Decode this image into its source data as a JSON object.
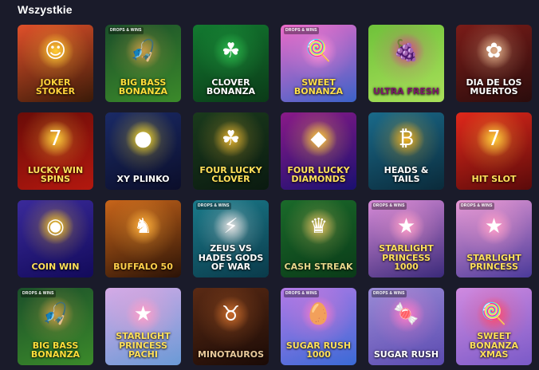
{
  "section": {
    "title": "Wszystkie"
  },
  "badge_text": "DROPS & WINS",
  "games": [
    {
      "title": "Joker Stoker",
      "bg1": "#3a1a08",
      "bg2": "#e0502a",
      "accent": "#ffcc33",
      "text_color": "#ffd23a",
      "emblem": "☺",
      "badge": false
    },
    {
      "title": "Big Bass Bonanza",
      "bg1": "#3b8a2a",
      "bg2": "#1b4f2a",
      "accent": "#c79b47",
      "text_color": "#ffdf3a",
      "emblem": "🎣",
      "badge": true
    },
    {
      "title": "Clover Bonanza",
      "bg1": "#0b3a18",
      "bg2": "#127a30",
      "accent": "#2ab54a",
      "text_color": "#ffffff",
      "emblem": "☘",
      "badge": false
    },
    {
      "title": "Sweet Bonanza",
      "bg1": "#3a62c8",
      "bg2": "#ec6cc8",
      "accent": "#ff8ed5",
      "text_color": "#ffe04a",
      "emblem": "🍭",
      "badge": true
    },
    {
      "title": "Ultra Fresh",
      "bg1": "#a9e05a",
      "bg2": "#6fc23a",
      "accent": "#d6458a",
      "text_color": "#7a1a68",
      "emblem": "🍇",
      "badge": false
    },
    {
      "title": "Dia de los Muertos",
      "bg1": "#2a0c0c",
      "bg2": "#7a1c18",
      "accent": "#e0b08a",
      "text_color": "#ffffff",
      "emblem": "✿",
      "badge": false
    },
    {
      "title": "Lucky Win Spins",
      "bg1": "#b3180f",
      "bg2": "#6a0c08",
      "accent": "#ffcf3a",
      "text_color": "#ffe05a",
      "emblem": "7",
      "badge": false
    },
    {
      "title": "XY Plinko",
      "bg1": "#0b0e2a",
      "bg2": "#1a2a66",
      "accent": "#ffe02a",
      "text_color": "#ffffff",
      "emblem": "●",
      "badge": false
    },
    {
      "title": "Four Lucky Clover",
      "bg1": "#0a1a10",
      "bg2": "#1a3a1c",
      "accent": "#e0b030",
      "text_color": "#ffe05a",
      "emblem": "☘",
      "badge": false
    },
    {
      "title": "Four Lucky Diamonds",
      "bg1": "#1a1070",
      "bg2": "#8a1a88",
      "accent": "#ffcf3a",
      "text_color": "#ffe05a",
      "emblem": "◆",
      "badge": false
    },
    {
      "title": "Heads & Tails",
      "bg1": "#0a2a3a",
      "bg2": "#1a6a8a",
      "accent": "#f0b020",
      "text_color": "#ffffff",
      "emblem": "₿",
      "badge": false
    },
    {
      "title": "Hit Slot",
      "bg1": "#5a0a0a",
      "bg2": "#e0281a",
      "accent": "#ffcf3a",
      "text_color": "#ffe05a",
      "emblem": "7",
      "badge": false
    },
    {
      "title": "Coin Win",
      "bg1": "#120a5a",
      "bg2": "#3a2a9a",
      "accent": "#ffcc22",
      "text_color": "#ffe05a",
      "emblem": "◉",
      "badge": false
    },
    {
      "title": "Buffalo 50",
      "bg1": "#2a1206",
      "bg2": "#c8651a",
      "accent": "#ffb03a",
      "text_color": "#ffcf4a",
      "emblem": "♞",
      "badge": false
    },
    {
      "title": "Zeus vs Hades Gods of War",
      "bg1": "#0a3a4a",
      "bg2": "#1a7a8a",
      "accent": "#e0e0e0",
      "text_color": "#ffffff",
      "emblem": "⚡",
      "badge": true
    },
    {
      "title": "Cash Streak",
      "bg1": "#0a3a18",
      "bg2": "#1a6a2a",
      "accent": "#e0c060",
      "text_color": "#e6d68a",
      "emblem": "♛",
      "badge": false
    },
    {
      "title": "Starlight Princess 1000",
      "bg1": "#3a2a7a",
      "bg2": "#d68ad6",
      "accent": "#ff9ec8",
      "text_color": "#ffe05a",
      "emblem": "★",
      "badge": true
    },
    {
      "title": "Starlight Princess",
      "bg1": "#4a3a9a",
      "bg2": "#e89ad6",
      "accent": "#ff9ec8",
      "text_color": "#ffe05a",
      "emblem": "★",
      "badge": true
    },
    {
      "title": "Big Bass Bonanza",
      "bg1": "#3b8a2a",
      "bg2": "#1b4f2a",
      "accent": "#c79b47",
      "text_color": "#ffdf3a",
      "emblem": "🎣",
      "badge": true
    },
    {
      "title": "Starlight Princess Pachi",
      "bg1": "#6a9ad6",
      "bg2": "#d6aae6",
      "accent": "#ff9ec8",
      "text_color": "#ffe05a",
      "emblem": "★",
      "badge": false
    },
    {
      "title": "Minotauros",
      "bg1": "#1a0a06",
      "bg2": "#5a2a14",
      "accent": "#c86a2a",
      "text_color": "#e8c89a",
      "emblem": "♉",
      "badge": false
    },
    {
      "title": "Sugar Rush 1000",
      "bg1": "#3a6ad6",
      "bg2": "#b47ae6",
      "accent": "#ff7ac8",
      "text_color": "#ffe05a",
      "emblem": "🥚",
      "badge": true
    },
    {
      "title": "Sugar Rush",
      "bg1": "#5a4ab0",
      "bg2": "#9a8ad6",
      "accent": "#ff7ac8",
      "text_color": "#ffffff",
      "emblem": "🍬",
      "badge": true
    },
    {
      "title": "Sweet Bonanza Xmas",
      "bg1": "#7a5ac8",
      "bg2": "#d08ae0",
      "accent": "#ff4a6a",
      "text_color": "#ffe05a",
      "emblem": "🍭",
      "badge": false
    }
  ]
}
